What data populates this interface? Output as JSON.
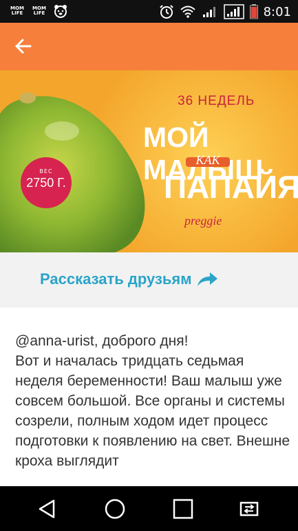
{
  "status_bar": {
    "time": "8:01",
    "app_icon_1": "MOM LIFE",
    "app_icon_2": "MOM LIFE",
    "icons": [
      "alarm-icon",
      "wifi-icon",
      "signal-icon",
      "signal-icon",
      "battery-icon"
    ]
  },
  "app_bar": {
    "color": "#f6803b",
    "back_icon": "back-arrow-icon"
  },
  "banner": {
    "weeks": "36 НЕДЕЛЬ",
    "line1": "МОЙ МАЛЫШ",
    "kak": "КАК",
    "line2": "ПАПАЙЯ",
    "brand": "preggie",
    "weight_small": "ВЕС",
    "weight": "2750 Г."
  },
  "share": {
    "label": "Рассказать друзьям",
    "icon": "share-arrow-icon",
    "color": "#2aa4c8"
  },
  "article": {
    "greeting": "@anna-urist, доброго дня!",
    "text": "Вот и началась тридцать седьмая неделя беременности! Ваш малыш уже совсем большой. Все органы и системы созрели, полным ходом идет процесс подготовки к появлению на свет. Внешне кроха выглядит"
  },
  "nav_bar": {
    "buttons": [
      "back-triangle-icon",
      "home-circle-icon",
      "recents-square-icon",
      "switch-icon"
    ]
  }
}
